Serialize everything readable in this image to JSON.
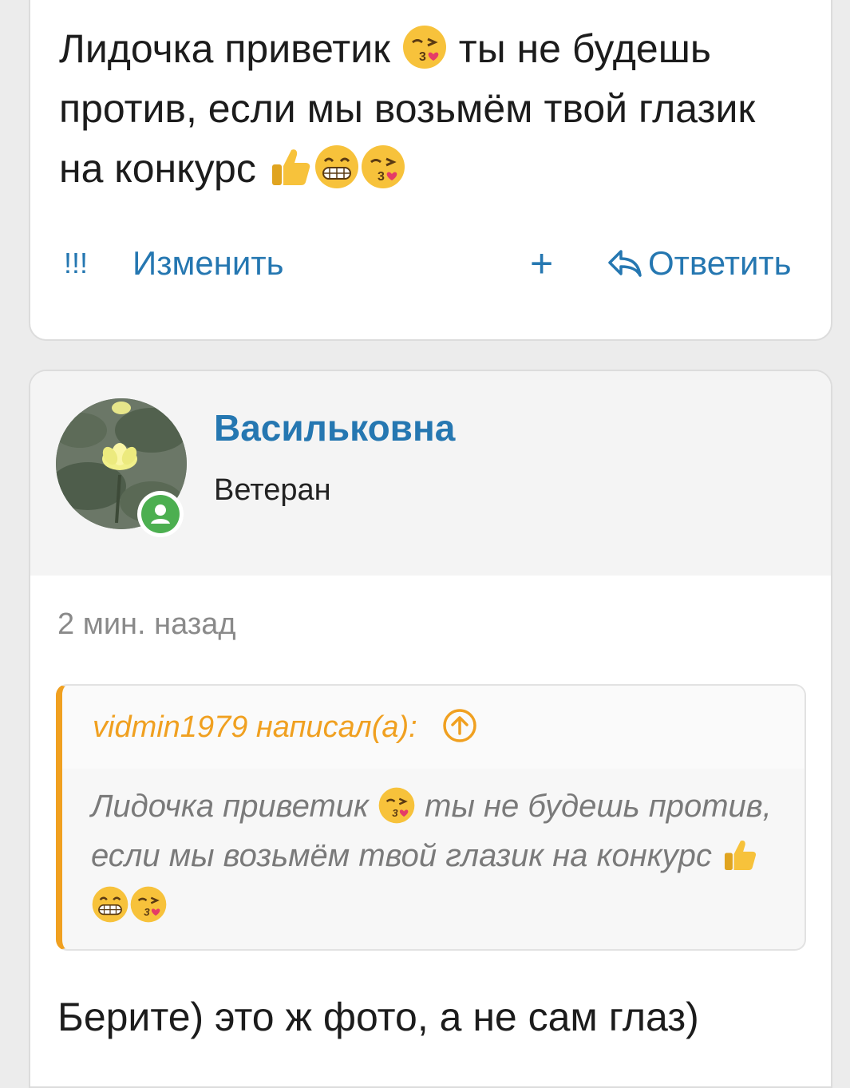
{
  "prev_post": {
    "text_parts": [
      "Лидочка приветик ",
      " ты не будешь против, если мы возьмём твой глазик на конкурс "
    ],
    "emoji": [
      "kissing-heart-emoji",
      "thumbs-up-emoji",
      "grin-emoji",
      "kissing-heart-emoji"
    ],
    "actions": {
      "report": "!!!",
      "edit": "Изменить",
      "add": "+",
      "reply": "Ответить"
    }
  },
  "post": {
    "username": "Васильковна",
    "user_title": "Ветеран",
    "timestamp": "2 мин. назад",
    "quote": {
      "author": "vidmin1979 написал(а):",
      "text_parts": [
        "Лидочка приветик ",
        " ты не будешь против, если мы возьмём твой глазик на конкурс "
      ]
    },
    "reply_text": "Берите) это ж фото, а не сам глаз)"
  },
  "colors": {
    "link": "#2577b1",
    "quote_accent": "#f0a020",
    "online": "#4caf50"
  }
}
